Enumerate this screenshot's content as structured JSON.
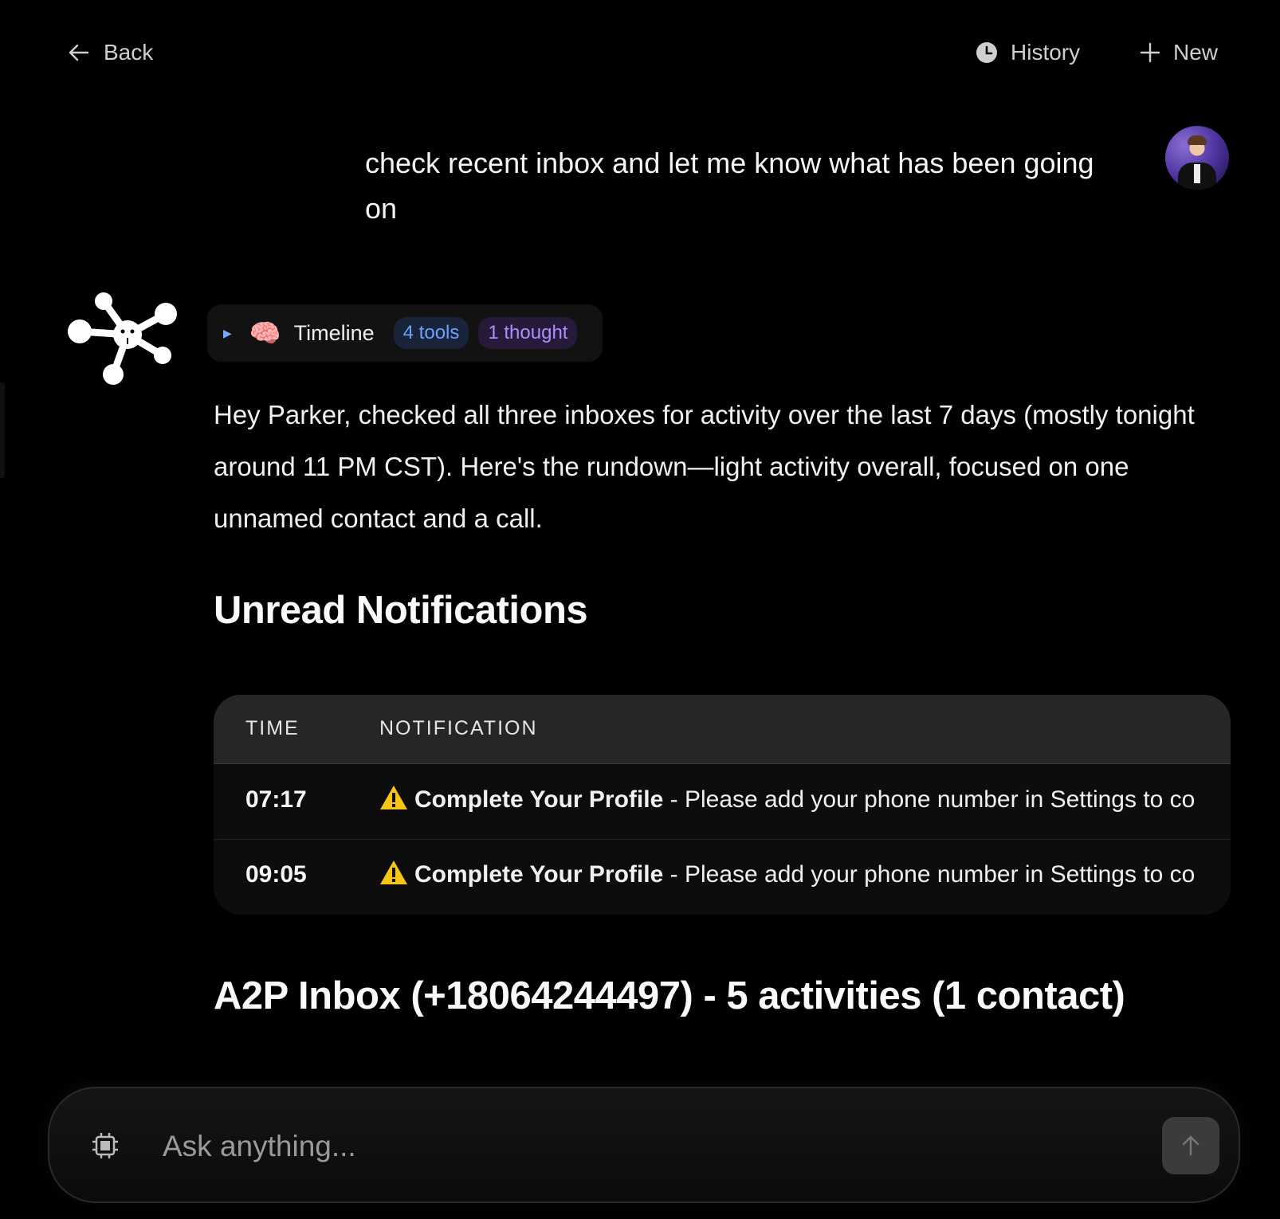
{
  "topbar": {
    "back_label": "Back",
    "history_label": "History",
    "new_label": "New"
  },
  "user_message": {
    "text": "check recent inbox and let me know what has been going on"
  },
  "assistant": {
    "timeline": {
      "label": "Timeline",
      "brain_icon": "🧠",
      "tools_badge": "4 tools",
      "thought_badge": "1 thought"
    },
    "intro": "Hey Parker, checked all three inboxes for activity over the last 7 days (mostly tonight around 11 PM CST). Here's the rundown—light activity overall, focused on one unnamed contact and a call.",
    "section1_title": "Unread Notifications",
    "table": {
      "headers": [
        "TIME",
        "NOTIFICATION"
      ],
      "rows": [
        {
          "time": "07:17",
          "title": "Complete Your Profile",
          "sep": " - ",
          "detail": "Please add your phone number in Settings to co"
        },
        {
          "time": "09:05",
          "title": "Complete Your Profile",
          "sep": " - ",
          "detail": "Please add your phone number in Settings to co"
        }
      ]
    },
    "section2_title": "A2P Inbox (+18064244497) - 5 activities (1 contact)"
  },
  "composer": {
    "placeholder": "Ask anything..."
  },
  "colors": {
    "background": "#000000",
    "tools_badge": "#6fa0ff",
    "thought_badge": "#b08cff",
    "table_header_bg": "#262626"
  },
  "icons": [
    "arrow-left-icon",
    "clock-icon",
    "plus-icon",
    "caret-right-icon",
    "brain-icon",
    "warning-icon",
    "chip-icon",
    "arrow-up-icon"
  ]
}
